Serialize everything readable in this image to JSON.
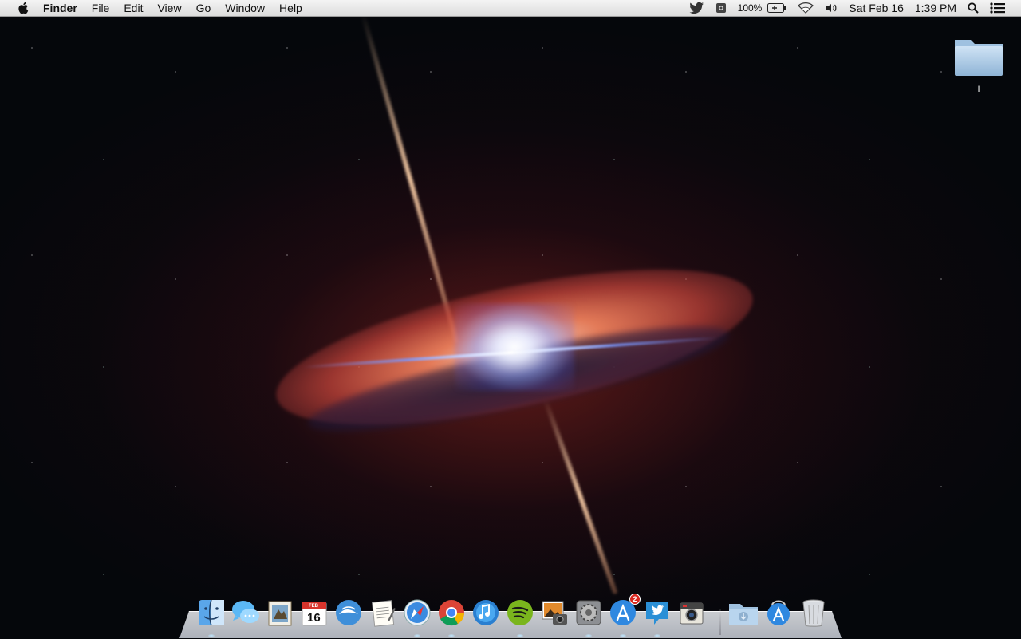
{
  "menubar": {
    "app_name": "Finder",
    "menus": [
      "File",
      "Edit",
      "View",
      "Go",
      "Window",
      "Help"
    ],
    "status": {
      "battery_percent": "100%",
      "date": "Sat Feb 16",
      "time": "1:39 PM"
    }
  },
  "desktop": {
    "folder_label": "I"
  },
  "dock": {
    "calendar": {
      "month": "FEB",
      "day": "16"
    },
    "app_store_badge": "2",
    "items": [
      "finder",
      "messages",
      "mail",
      "calendar",
      "openoffice",
      "textedit",
      "safari",
      "chrome",
      "itunes",
      "spotify",
      "iphoto",
      "system-preferences",
      "app-store",
      "twitter",
      "photo-booth",
      "downloads-stack",
      "applications-stack",
      "trash"
    ]
  },
  "colors": {
    "menubar_bg": "#e6e6e6",
    "badge_red": "#d9261e"
  }
}
